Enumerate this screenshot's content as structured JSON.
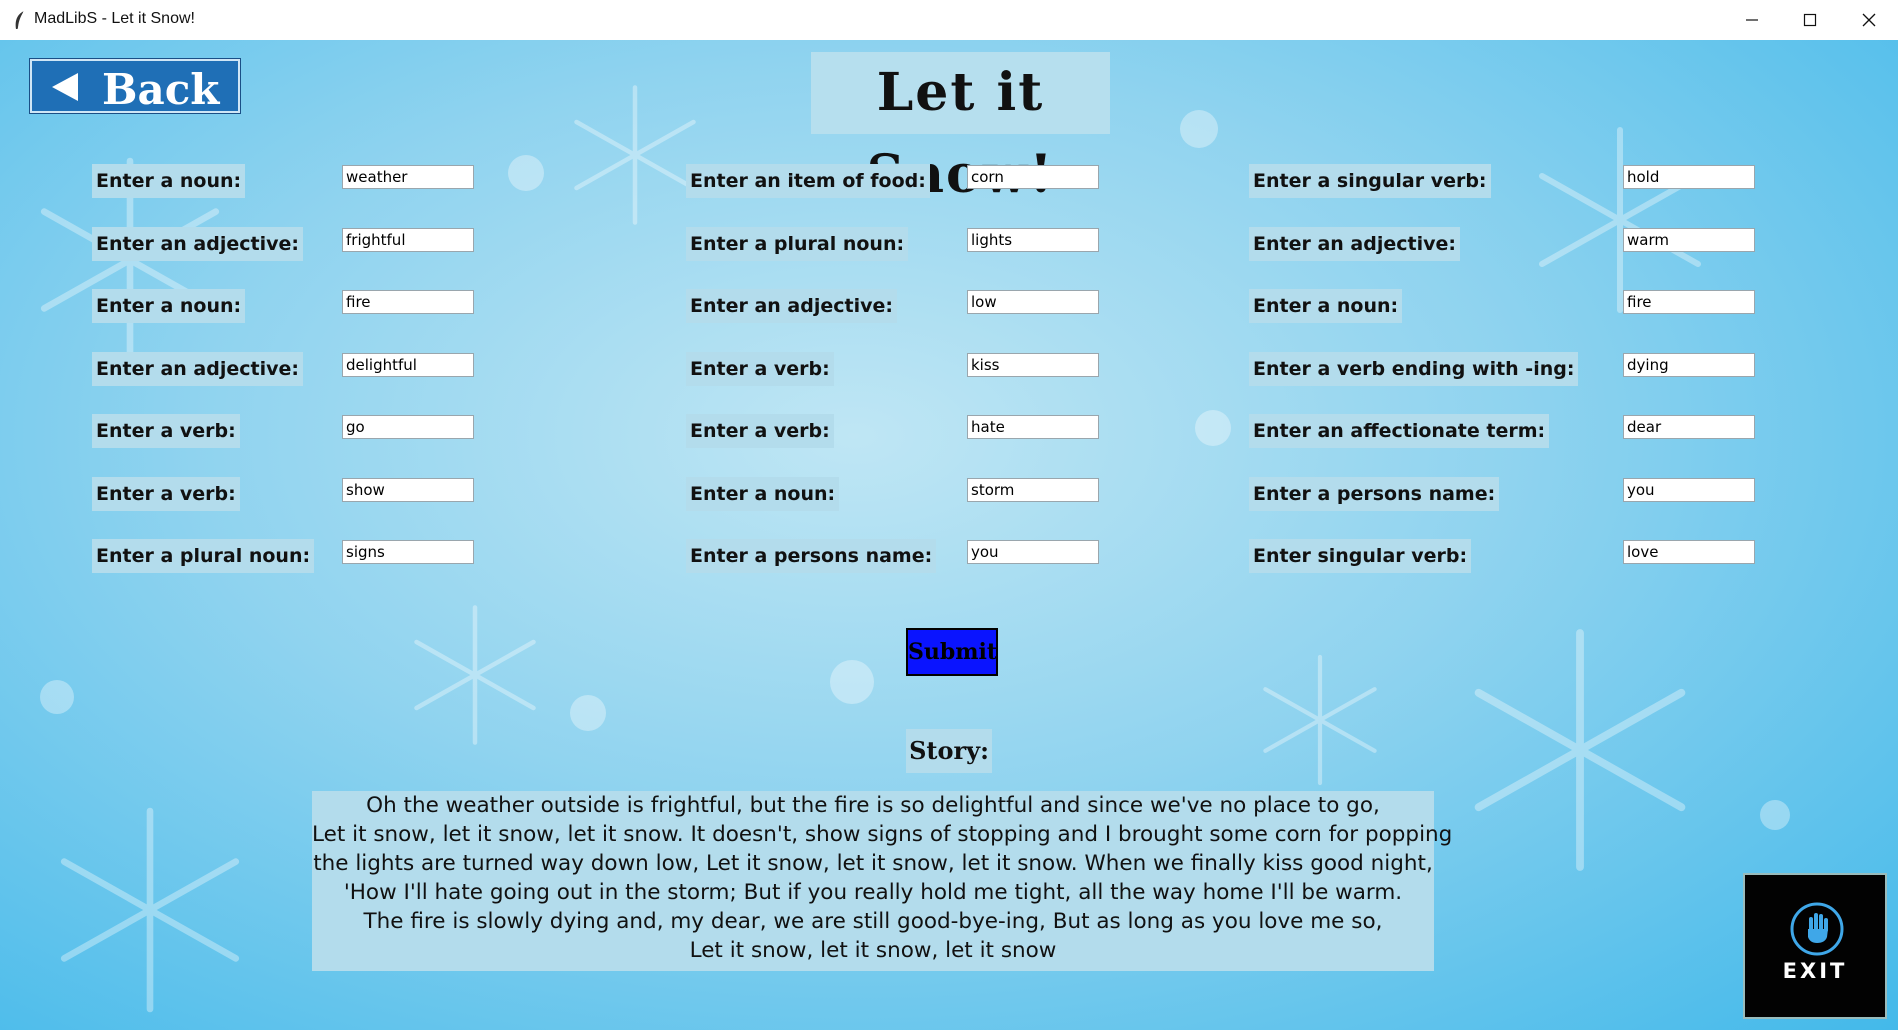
{
  "window": {
    "title": "MadLibS - Let it Snow!"
  },
  "header": {
    "back_label": "Back",
    "title": "Let it Snow!"
  },
  "columns": [
    [
      {
        "label": "Enter a noun:",
        "value": "weather"
      },
      {
        "label": "Enter an adjective:",
        "value": "frightful"
      },
      {
        "label": "Enter a noun:",
        "value": "fire"
      },
      {
        "label": "Enter an adjective:",
        "value": "delightful"
      },
      {
        "label": "Enter a verb:",
        "value": "go"
      },
      {
        "label": "Enter a verb:",
        "value": "show"
      },
      {
        "label": "Enter a plural noun:",
        "value": "signs"
      }
    ],
    [
      {
        "label": "Enter an item of food:",
        "value": "corn"
      },
      {
        "label": "Enter a plural noun:",
        "value": "lights"
      },
      {
        "label": "Enter an adjective:",
        "value": "low"
      },
      {
        "label": "Enter a verb:",
        "value": "kiss"
      },
      {
        "label": "Enter a verb:",
        "value": "hate"
      },
      {
        "label": "Enter a noun:",
        "value": "storm"
      },
      {
        "label": "Enter a persons name:",
        "value": "you"
      }
    ],
    [
      {
        "label": "Enter a singular verb:",
        "value": "hold"
      },
      {
        "label": "Enter an adjective:",
        "value": "warm"
      },
      {
        "label": "Enter a noun:",
        "value": "fire"
      },
      {
        "label": "Enter a verb ending with -ing:",
        "value": "dying"
      },
      {
        "label": "Enter an affectionate term:",
        "value": "dear"
      },
      {
        "label": "Enter a persons name:",
        "value": "you"
      },
      {
        "label": "Enter singular verb:",
        "value": "love"
      }
    ]
  ],
  "submit_label": "Submit",
  "story": {
    "heading": "Story:",
    "lines": [
      "Oh the weather outside is frightful, but the fire is so delightful and since we've no place to go,",
      "Let it snow, let it snow, let it snow. It doesn't, show signs of stopping and I brought some corn for popping",
      "the lights are turned way down low, Let it snow, let it snow, let it snow. When we finally kiss good night,",
      "'How I'll hate going out in the storm; But if you really hold me tight, all the way home I'll be warm.",
      "The fire is slowly dying and, my dear, we are still good-bye-ing, But as long as you love me so,",
      "Let it snow, let it snow, let it snow"
    ]
  },
  "exit_label": "EXIT",
  "icons": {
    "app": "feather-icon",
    "back": "triangle-left-icon",
    "exit": "hand-stop-icon",
    "minimize": "minimize-icon",
    "maximize": "maximize-icon",
    "close": "close-icon"
  },
  "colors": {
    "back_button": "#1f6fb6",
    "submit_button": "#0a14ff",
    "label_bg": "#b3dcec",
    "exit_button": "#020202"
  }
}
